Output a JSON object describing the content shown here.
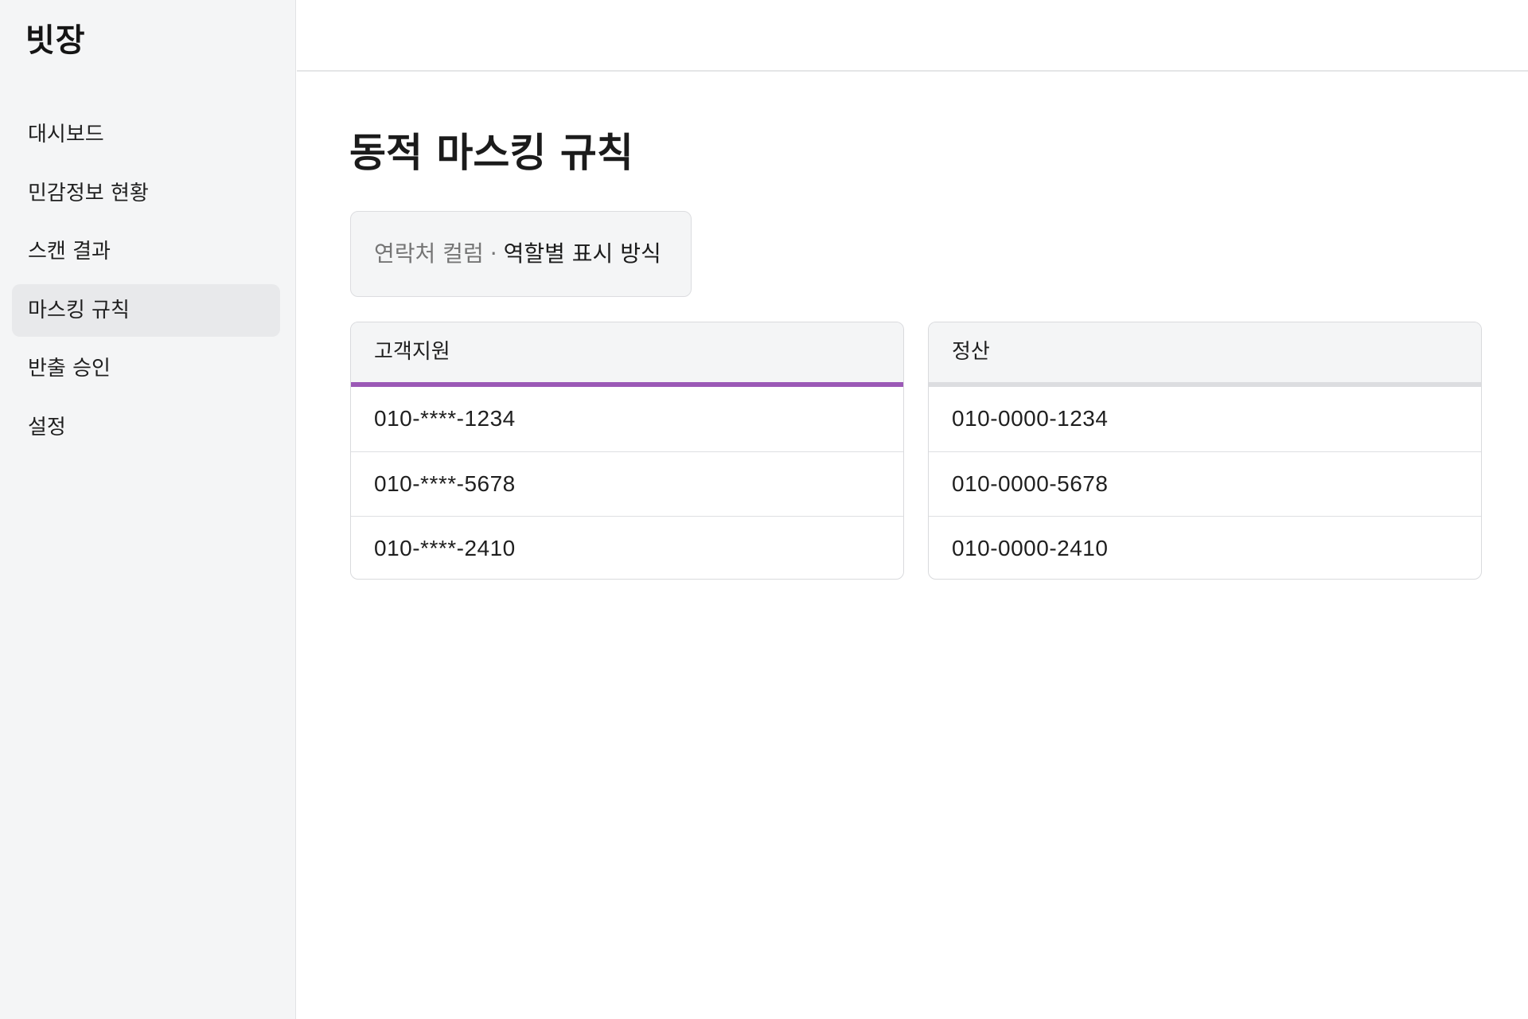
{
  "app": {
    "logo": "빗장"
  },
  "sidebar": {
    "items": [
      {
        "label": "대시보드",
        "active": false
      },
      {
        "label": "민감정보 현황",
        "active": false
      },
      {
        "label": "스캔 결과",
        "active": false
      },
      {
        "label": "마스킹 규칙",
        "active": true
      },
      {
        "label": "반출 승인",
        "active": false
      },
      {
        "label": "설정",
        "active": false
      }
    ]
  },
  "main": {
    "title": "동적 마스킹 규칙",
    "context": {
      "column": "연락처 컬럼",
      "separator": "·",
      "mode": "역할별 표시 방식"
    },
    "roles": [
      {
        "name": "고객지원",
        "accent_color": "#9b59b6",
        "values": [
          "010-****-1234",
          "010-****-5678",
          "010-****-2410"
        ]
      },
      {
        "name": "정산",
        "accent_color": "#dcdde0",
        "values": [
          "010-0000-1234",
          "010-0000-5678",
          "010-0000-2410"
        ]
      }
    ]
  },
  "colors": {
    "sidebar_bg": "#f4f5f6",
    "active_item_bg": "#e8e9eb",
    "masked_accent": "#9b59b6",
    "neutral_accent": "#dcdde0"
  }
}
